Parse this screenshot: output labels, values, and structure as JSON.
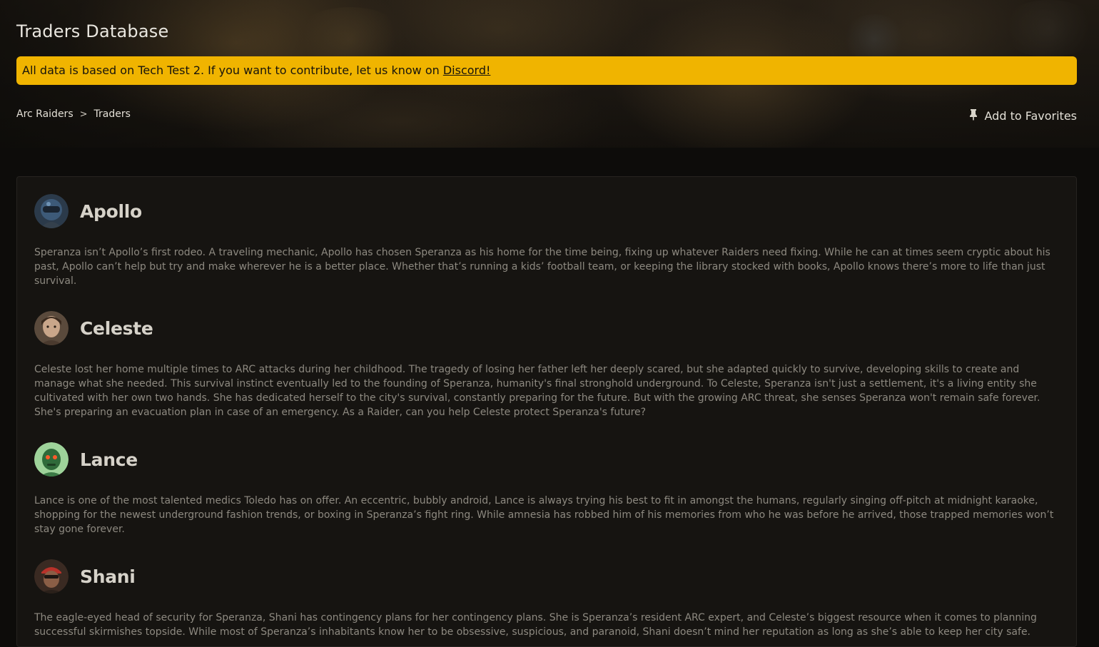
{
  "header": {
    "title": "Traders Database"
  },
  "notice": {
    "text": "All data is based on Tech Test 2. If you want to contribute, let us know on ",
    "link_label": "Discord!",
    "color": "#f0b400"
  },
  "breadcrumb": {
    "items": [
      "Arc Raiders",
      "Traders"
    ],
    "separator": ">"
  },
  "favorites": {
    "label": "Add to Favorites",
    "icon": "pin-icon"
  },
  "traders": [
    {
      "name": "Apollo",
      "description": "Speranza isn’t Apollo’s first rodeo. A traveling mechanic, Apollo has chosen Speranza as his home for the time being, fixing up whatever Raiders need fixing. While he can at times seem cryptic about his past, Apollo can’t help but try and make wherever he is a better place. Whether that’s running a kids’ football team, or keeping the library stocked with books, Apollo knows there’s more to life than just survival."
    },
    {
      "name": "Celeste",
      "description": "Celeste lost her home multiple times to ARC attacks during her childhood. The tragedy of losing her father left her deeply scared, but she adapted quickly to survive, developing skills to create and manage what she needed. This survival instinct eventually led to the founding of Speranza, humanity's final stronghold underground. To Celeste, Speranza isn't just a settlement, it's a living entity she cultivated with her own two hands. She has dedicated herself to the city's survival, constantly preparing for the future. But with the growing ARC threat, she senses Speranza won't remain safe forever. She's preparing an evacuation plan in case of an emergency. As a Raider, can you help Celeste protect Speranza's future?"
    },
    {
      "name": "Lance",
      "description": "Lance is one of the most talented medics Toledo has on offer. An eccentric, bubbly android, Lance is always trying his best to fit in amongst the humans, regularly singing off-pitch at midnight karaoke, shopping for the newest underground fashion trends, or boxing in Speranza’s fight ring. While amnesia has robbed him of his memories from who he was before he arrived, those trapped memories won’t stay gone forever."
    },
    {
      "name": "Shani",
      "description": "The eagle-eyed head of security for Speranza, Shani has contingency plans for her contingency plans. She is Speranza’s resident ARC expert, and Celeste’s biggest resource when it comes to planning successful skirmishes topside. While most of Speranza’s inhabitants know her to be obsessive, suspicious, and paranoid, Shani doesn’t mind her reputation as long as she’s able to keep her city safe."
    }
  ]
}
